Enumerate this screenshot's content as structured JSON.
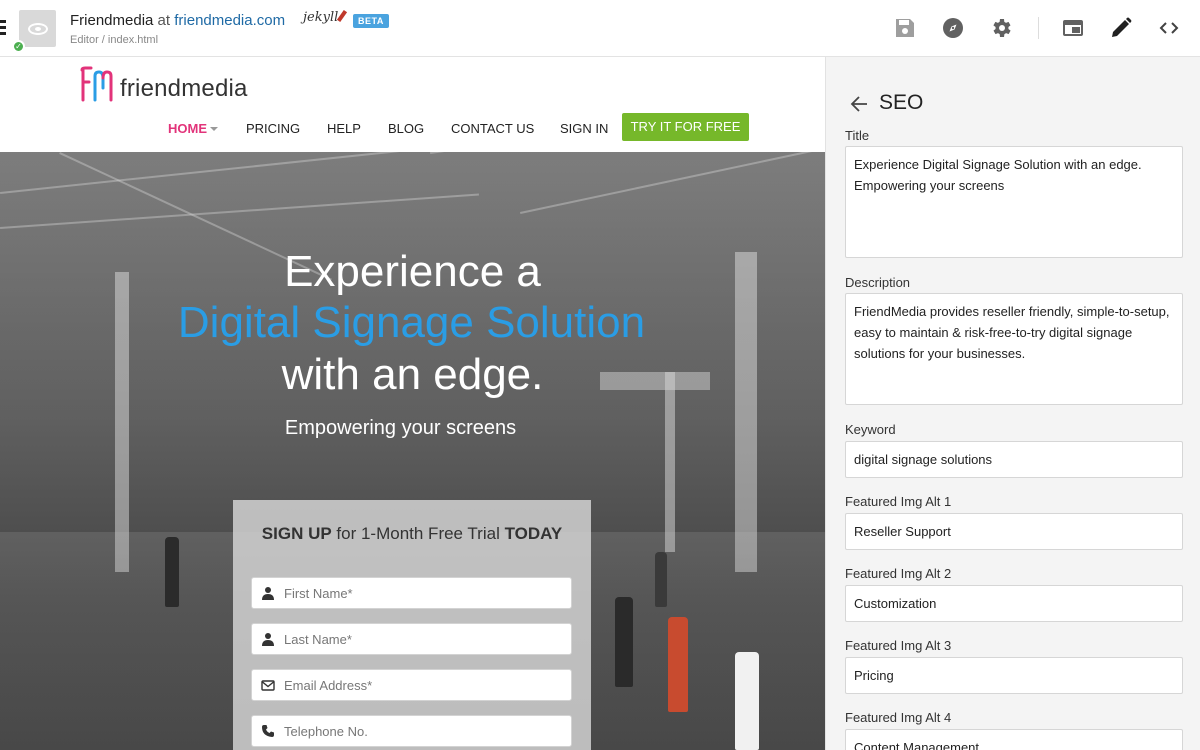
{
  "topbar": {
    "site_name": "Friendmedia",
    "at": "at",
    "domain": "friendmedia.com",
    "jekyll": "jekyll",
    "beta": "BETA",
    "breadcrumb": "Editor / index.html",
    "icons": [
      "save-icon",
      "compass-icon",
      "gear-icon",
      "window-icon",
      "pencil-icon",
      "code-icon"
    ]
  },
  "site": {
    "logo_text": "friendmedia",
    "nav": [
      {
        "label": "HOME",
        "active": true
      },
      {
        "label": "PRICING"
      },
      {
        "label": "HELP"
      },
      {
        "label": "BLOG"
      },
      {
        "label": "CONTACT US"
      },
      {
        "label": "SIGN IN"
      }
    ],
    "cta": "TRY IT FOR FREE",
    "hero": {
      "line1": "Experience a",
      "line2": "Digital Signage Solution",
      "line3": "with an edge.",
      "subtitle": "Empowering your screens"
    },
    "signup": {
      "title_bold1": "SIGN UP",
      "title_mid": " for 1-Month Free Trial ",
      "title_bold2": "TODAY",
      "fields": [
        {
          "placeholder": "First Name*",
          "icon": "person-icon"
        },
        {
          "placeholder": "Last Name*",
          "icon": "person-icon"
        },
        {
          "placeholder": "Email Address*",
          "icon": "envelope-icon"
        },
        {
          "placeholder": "Telephone No.",
          "icon": "phone-icon"
        }
      ]
    }
  },
  "panel": {
    "heading": "SEO",
    "fields": [
      {
        "label": "Title",
        "value": "Experience Digital Signage Solution with an edge. Empowering your screens"
      },
      {
        "label": "Description",
        "value": "FriendMedia provides reseller friendly, simple-to-setup, easy to maintain & risk-free-to-try digital signage solutions for your businesses."
      },
      {
        "label": "Keyword",
        "value": "digital signage solutions"
      },
      {
        "label": "Featured Img Alt 1",
        "value": "Reseller Support"
      },
      {
        "label": "Featured Img Alt 2",
        "value": "Customization"
      },
      {
        "label": "Featured Img Alt 3",
        "value": "Pricing"
      },
      {
        "label": "Featured Img Alt 4",
        "value": "Content Management"
      }
    ]
  },
  "colors": {
    "accent_pink": "#e2337a",
    "hero_blue": "#2a9de5",
    "cta_green": "#76b82a",
    "beta_blue": "#4aa3df",
    "status_green": "#4caf50"
  }
}
